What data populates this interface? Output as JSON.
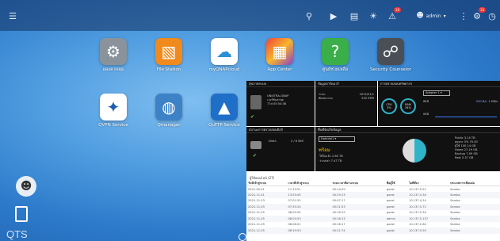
{
  "taskbar": {
    "user": "admin",
    "notifications_count": "10",
    "updates_count": "10"
  },
  "apps": [
    {
      "label": "แผงควบคุม",
      "icon": "gear-icon",
      "color": "#8a939c"
    },
    {
      "label": "File Station",
      "icon": "folder-icon",
      "color": "#f08a1c"
    },
    {
      "label": "myQNAPcloud",
      "icon": "cloud-icon",
      "color": "#ffffff"
    },
    {
      "label": "App Center",
      "icon": "app-grid-icon",
      "color": "#e34a7a"
    },
    {
      "label": "ศูนย์ช่วยเหลือ",
      "icon": "help-icon",
      "color": "#3aae49"
    },
    {
      "label": "Security Counselor",
      "icon": "shield-lock-icon",
      "color": "#4a4f57"
    },
    {
      "label": "QVPN Service",
      "icon": "vpn-icon",
      "color": "#ffffff"
    },
    {
      "label": "Qmanager",
      "icon": "qmanager-icon",
      "color": "#3d82c7"
    },
    {
      "label": "QuFTP Service",
      "icon": "ftp-icon",
      "color": "#1f6fc8"
    }
  ],
  "brand": "QTS",
  "dashboard": {
    "system": {
      "title": "สุขภาพระบบ",
      "model": "UNIXTRA-QNAP",
      "sub1": "เวอร์ชันล่าสุด",
      "sub2": "77d 05:54:38"
    },
    "hardware": {
      "title": "ข้อมูลฮาร์ดแวร์",
      "row1_label": "ระบบ",
      "row1_value": "2015/01/1",
      "row2_label": "พัดลมระบบ",
      "row2_value": "532 RPM"
    },
    "resource": {
      "title": "การตรวจสอบทรัพยากร",
      "cpu_label": "CPU",
      "cpu_value": "3%",
      "ram_label": "RAM",
      "ram_value": "34%",
      "adapter": "Adapter 1",
      "rate_up": "250 B/s",
      "rate_down": "1 KB/s",
      "scale1": "6KB",
      "scale2": "0KB",
      "cpu_fraction": 0.03,
      "ram_fraction": 0.34
    },
    "disk": {
      "title": "สถานะการตรวจสอบดิสก์",
      "name": "Disk1",
      "disk_count": "3 / 6 ดิสก์",
      "status": "Good"
    },
    "storage": {
      "title": "พื้นที่จัดเก็บข้อมูล",
      "volume": "DataVol1",
      "state": "พร้อม",
      "used": "ใช้ไปแล้ว 2.60 TB",
      "free": "ว่างเปล่า 7.47 TB",
      "legend": [
        "Public 3.14 TB",
        "qsync 3% 70.00",
        "ผู้ใช้ 100.14 GB",
        "Home 27.19 GB",
        "Backup 7.09 GB",
        "Rest 5.37 GB"
      ]
    },
    "users": {
      "title": "ผู้ใช้ออนไลน์ (27)",
      "columns": [
        "วันที่เข้าสู่ระบบ",
        "เวลาที่เข้าสู่ระบบ",
        "ระยะเวลาที่ผ่านระบบ",
        "ชื่อผู้ใช้",
        "ไอพีที่มา",
        "ประเภทการเชื่อมต่อ"
      ],
      "rows": [
        [
          "2021-05-01",
          "17:13:51",
          "00:14:09",
          "guest",
          "10.137.5.51",
          "Samba"
        ],
        [
          "2021-11-01",
          "13:53:45",
          "00:19:13",
          "guest",
          "10.137.4.34",
          "Samba"
        ],
        [
          "2021-11-03",
          "07:01:55",
          "00:07:17",
          "guest",
          "10.137.4.24",
          "Samba"
        ],
        [
          "2021-11-05",
          "07:55:24",
          "00:21:53",
          "guest",
          "10.137.5.72",
          "Samba"
        ],
        [
          "2021-11-05",
          "08:05:55",
          "00:18:15",
          "guest",
          "10.137.5.34",
          "Samba"
        ],
        [
          "2021-11-05",
          "08:03:53",
          "00:18:13",
          "admin",
          "10.137.5.157",
          "Samba"
        ],
        [
          "2021-11-05",
          "08:06:01",
          "00:18:17",
          "guest",
          "10.137.2.64",
          "Samba"
        ],
        [
          "2021-11-05",
          "08:19:53",
          "00:21:74",
          "guest",
          "10.137.5.93",
          "Samba"
        ]
      ]
    }
  }
}
